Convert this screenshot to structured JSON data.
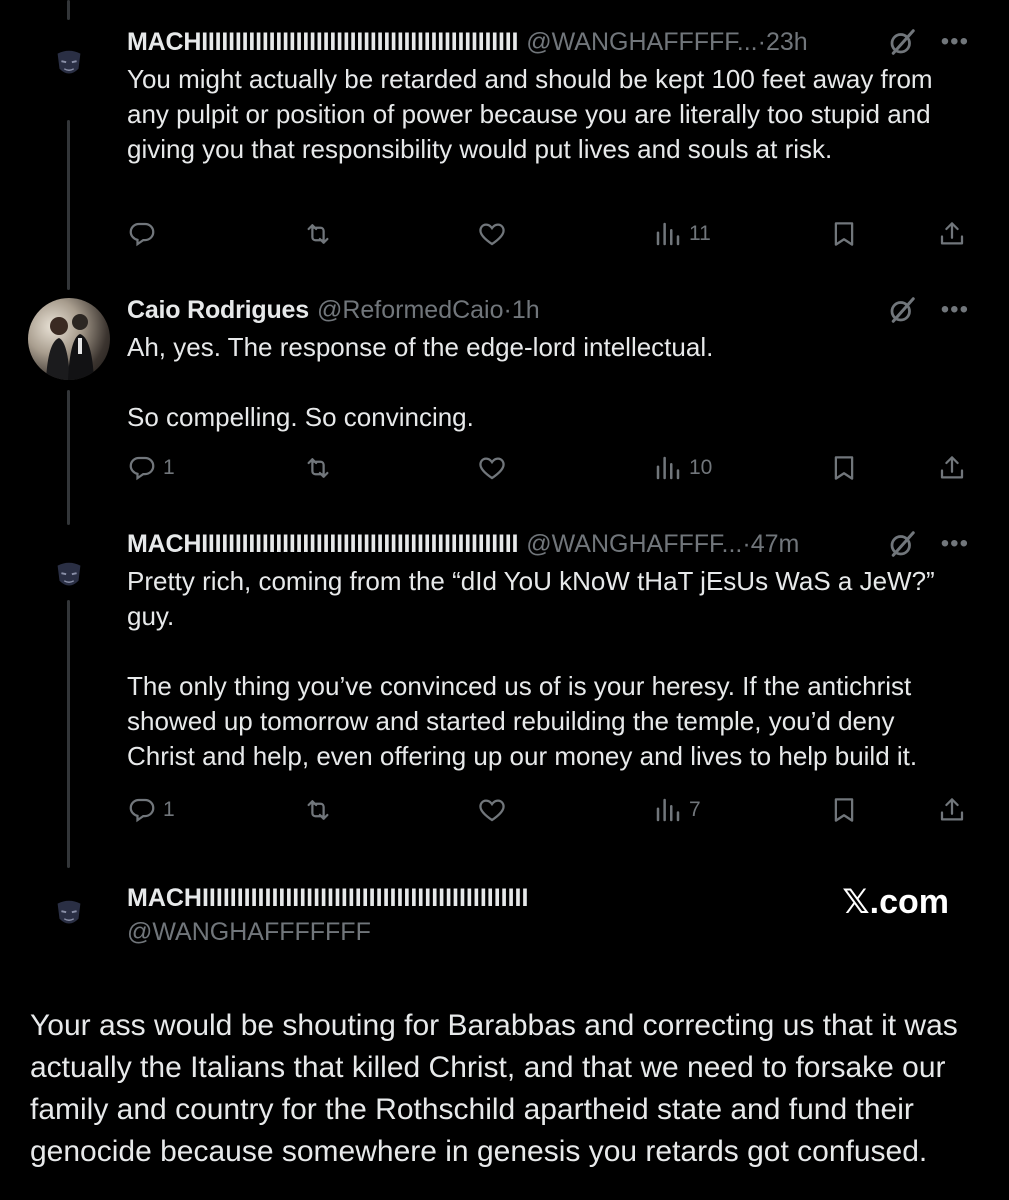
{
  "tweets": [
    {
      "name": "MACHIIIIIIIIIIIIIIIIIIIIIIIIIIIIIIIIIIIIIIIIIIIIIII",
      "handle": "@WANGHAFFFFF...",
      "sep": " · ",
      "time": "23h",
      "paragraphs": [
        "You might actually be retarded and should be kept 100 feet away from any pulpit or position of power because you are literally too stupid and giving you that responsibility would put lives and souls at risk."
      ],
      "replies": "",
      "views": "11"
    },
    {
      "name": "Caio Rodrigues",
      "handle": "@ReformedCaio",
      "sep": " · ",
      "time": "1h",
      "paragraphs": [
        "Ah, yes. The response of the edge-lord intellectual.",
        "So compelling. So convincing."
      ],
      "replies": "1",
      "views": "10"
    },
    {
      "name": "MACHIIIIIIIIIIIIIIIIIIIIIIIIIIIIIIIIIIIIIIIIIIIIIII",
      "handle": "@WANGHAFFFF...",
      "sep": " · ",
      "time": "47m",
      "paragraphs": [
        "Pretty rich, coming from the “dId YoU kNoW tHaT jEsUs WaS a JeW?” guy.",
        "The only thing you’ve convinced us of is your heresy. If the antichrist showed up tomorrow and started rebuilding the temple, you’d deny Christ and help, even offering up our money and lives to help build it."
      ],
      "replies": "1",
      "views": "7"
    }
  ],
  "card": {
    "name": "MACHIIIIIIIIIIIIIIIIIIIIIIIIIIIIIIIIIIIIIIIIIIIIIII",
    "handle": "@WANGHAFFFFFFF",
    "brand": "𝕏.com",
    "text": "Your ass would be shouting for Barabbas and correcting us that it was actually the Italians that killed Christ, and that we need to forsake our family and country for the Rothschild apartheid state and fund their genocide because somewhere in genesis you retards got confused."
  },
  "icons": {
    "reply": "reply-icon",
    "retweet": "retweet-icon",
    "like": "heart-icon",
    "views": "views-icon",
    "bookmark": "bookmark-icon",
    "share": "share-icon",
    "grok": "grok-icon",
    "more": "more-icon"
  },
  "colors": {
    "background": "#000000",
    "text": "#e7e9ea",
    "secondary": "#71767b",
    "thread": "#333639"
  }
}
